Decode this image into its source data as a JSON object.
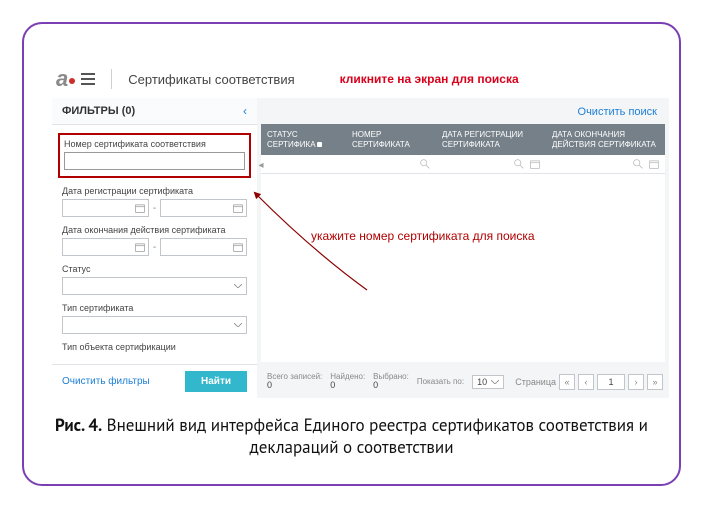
{
  "header": {
    "title": "Сертификаты соответствия",
    "hint": "кликните на экран для поиска"
  },
  "filters": {
    "title": "ФИЛЬТРЫ (0)",
    "cert_number_label": "Номер сертификата соответствия",
    "reg_date_label": "Дата регистрации сертификата",
    "end_date_label": "Дата окончания действия сертификата",
    "status_label": "Статус",
    "cert_type_label": "Тип сертификата",
    "obj_type_label": "Тип объекта сертификации",
    "clear": "Очистить фильтры",
    "find": "Найти"
  },
  "main": {
    "clear_search": "Очистить поиск",
    "columns": {
      "c1": "СТАТУС СЕРТИФИКА",
      "c2": "НОМЕР СЕРТИФИКАТА",
      "c3": "ДАТА РЕГИСТРАЦИИ СЕРТИФИКАТА",
      "c4": "ДАТА ОКОНЧАНИЯ ДЕЙСТВИЯ СЕРТИФИКАТА"
    },
    "annotation": "укажите номер сертификата для поиска"
  },
  "pager": {
    "total_label": "Всего записей:",
    "total_val": "0",
    "found_label": "Найдено:",
    "found_val": "0",
    "selected_label": "Выбрано:",
    "selected_val": "0",
    "show_label": "Показать по:",
    "page_size": "10",
    "page_label": "Страница",
    "page_current": "1"
  },
  "caption": {
    "bold": "Рис. 4.",
    "rest": " Внешний вид интерфейса Единого реестра сертификатов соответствия и деклараций о соответствии"
  }
}
